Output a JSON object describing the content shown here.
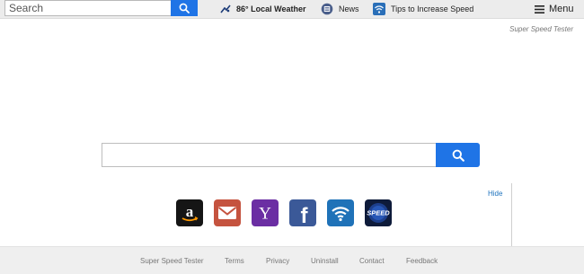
{
  "topbar": {
    "search_placeholder": "Search",
    "weather": {
      "temp": "86°",
      "label": "Local Weather"
    },
    "news_label": "News",
    "tips_label": "Tips to Increase Speed",
    "menu_label": "Menu"
  },
  "brand_name": "Super Speed Tester",
  "main": {
    "search_value": "",
    "hide_label": "Hide",
    "shortcuts": [
      {
        "name": "Amazon",
        "icon": "amazon-icon"
      },
      {
        "name": "Gmail",
        "icon": "gmail-icon"
      },
      {
        "name": "Yahoo",
        "icon": "yahoo-icon"
      },
      {
        "name": "Facebook",
        "icon": "facebook-icon"
      },
      {
        "name": "WiFi",
        "icon": "wifi-icon"
      },
      {
        "name": "Speed",
        "icon": "speed-icon",
        "text": "SPEED"
      }
    ]
  },
  "footer": {
    "links": [
      "Super Speed Tester",
      "Terms",
      "Privacy",
      "Uninstall",
      "Contact",
      "Feedback"
    ]
  },
  "colors": {
    "accent_blue": "#1f74e6",
    "toolbar_bg": "#ececec",
    "footer_bg": "#efefef",
    "link_blue": "#1e73be"
  }
}
